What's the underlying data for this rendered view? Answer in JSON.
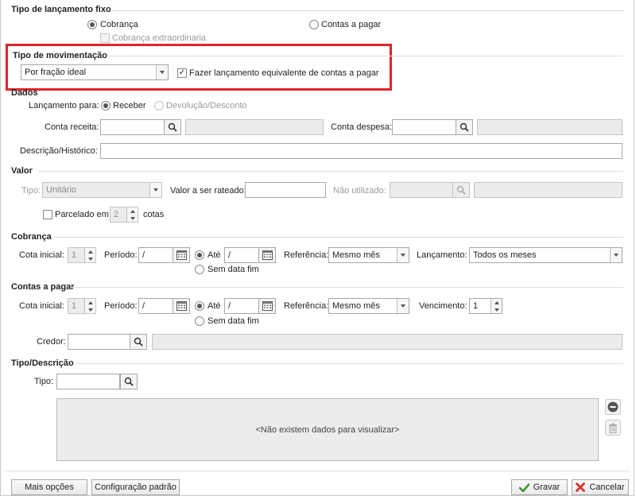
{
  "tipo_fixo": {
    "title": "Tipo de lançamento fixo",
    "cobranca": "Cobrança",
    "contas_pagar": "Contas a pagar",
    "extraordinaria": "Cobrança extraordinaria"
  },
  "tipo_mov": {
    "title": "Tipo de movimentação",
    "select_value": "Por fração ideal",
    "checkbox_label": "Fazer lançamento equivalente de contas a pagar"
  },
  "dados": {
    "title": "Dados",
    "lancamento_para": "Lançamento para:",
    "receber": "Receber",
    "devolucao": "Devolução/Desconto",
    "conta_receita": "Conta receita:",
    "conta_despesa": "Conta despesa:",
    "descricao": "Descrição/Histórico:"
  },
  "valor": {
    "title": "Valor",
    "tipo_label": "Tipo:",
    "tipo_value": "Unitário",
    "valor_rateado": "Valor a ser rateado:",
    "nao_utilizado": "Não utilizado:",
    "parcelado_em": "Parcelado em",
    "parcelas": "2",
    "cotas": "cotas"
  },
  "cobranca": {
    "title": "Cobrança",
    "cota_inicial": "Cota inicial:",
    "cota_value": "1",
    "periodo": "Período:",
    "periodo_value": "/",
    "ate": "Até",
    "ate_value": "/",
    "sem_data_fim": "Sem data fim",
    "referencia": "Referência:",
    "referencia_value": "Mesmo mês",
    "lancamento": "Lançamento:",
    "lancamento_value": "Todos os meses"
  },
  "contas": {
    "title": "Contas a pagar",
    "cota_inicial": "Cota inicial:",
    "cota_value": "1",
    "periodo": "Período:",
    "periodo_value": "/",
    "ate": "Até",
    "ate_value": "/",
    "sem_data_fim": "Sem data fim",
    "referencia": "Referência:",
    "referencia_value": "Mesmo mês",
    "vencimento": "Vencimento:",
    "vencimento_value": "1",
    "credor": "Credor:"
  },
  "tipo_desc": {
    "title": "Tipo/Descrição",
    "tipo_label": "Tipo:",
    "empty": "<Não existem dados para visualizar>"
  },
  "footer": {
    "mais_opcoes": "Mais opções",
    "config_padrao": "Configuração padrão",
    "gravar": "Gravar",
    "cancelar": "Cancelar"
  },
  "colors": {
    "highlight": "#e0242b",
    "check_green": "#3a9a2e",
    "cancel_red": "#d9342b"
  }
}
